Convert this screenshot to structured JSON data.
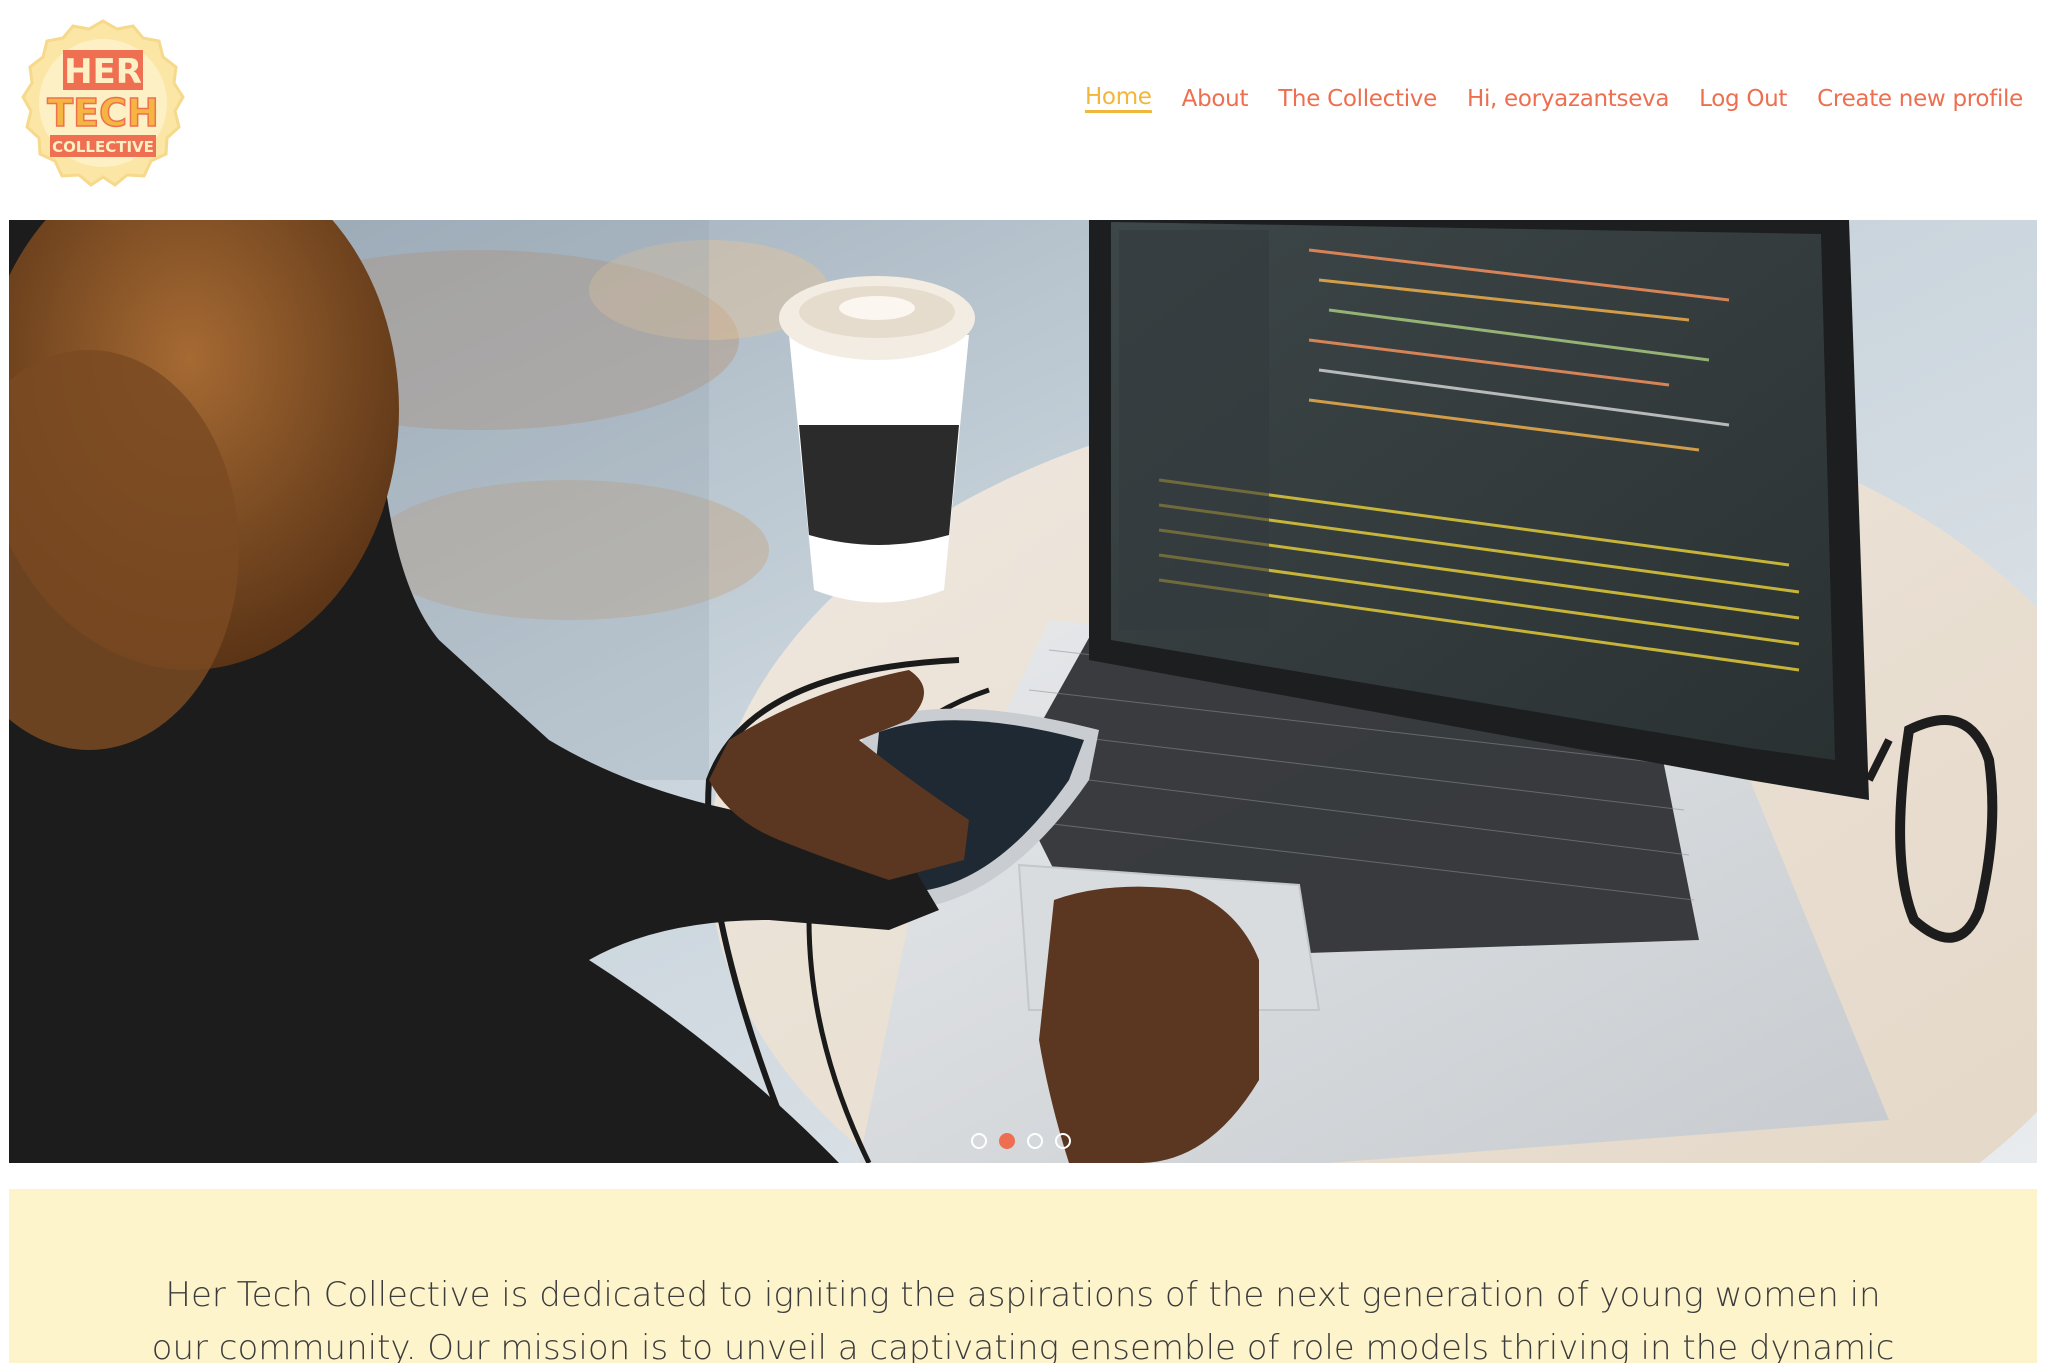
{
  "brand": {
    "logo_line1": "HER",
    "logo_line2": "TECH",
    "logo_line3": "COLLECTIVE"
  },
  "nav": {
    "items": [
      {
        "label": "Home",
        "active": true
      },
      {
        "label": "About",
        "active": false
      },
      {
        "label": "The Collective",
        "active": false
      },
      {
        "label": "Hi, eoryazantseva",
        "active": false
      },
      {
        "label": "Log Out",
        "active": false
      },
      {
        "label": "Create new profile",
        "active": false
      }
    ]
  },
  "carousel": {
    "slide_count": 4,
    "active_index": 1
  },
  "mission": {
    "text": "Her Tech Collective is dedicated to igniting the aspirations of the next generation of young women in our community. Our mission is to unveil a captivating ensemble of role models thriving in the dynamic"
  },
  "colors": {
    "accent": "#ee6f50",
    "active_nav": "#f2b73a",
    "mission_bg": "#fef4cc",
    "text": "#3c3c3c"
  }
}
